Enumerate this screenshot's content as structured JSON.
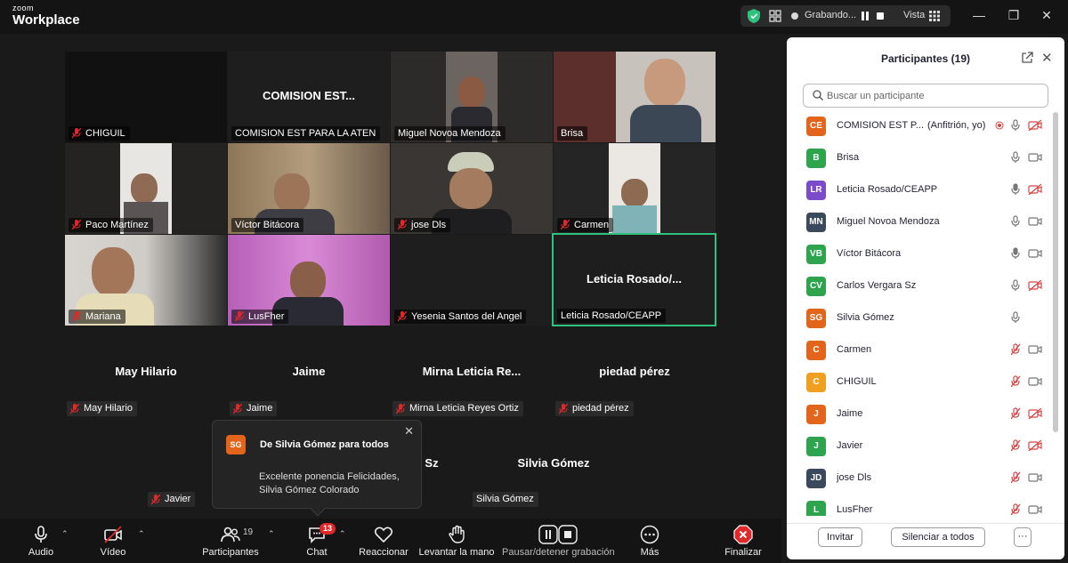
{
  "app": {
    "logo_small": "zoom",
    "logo_big": "Workplace"
  },
  "titlebar": {
    "recording_text": "Grabando...",
    "view_label": "Vista"
  },
  "tiles": [
    {
      "label": "CHIGUIL",
      "big_name": "",
      "color": "#111111"
    },
    {
      "label": "COMISION EST PARA LA ATEN",
      "big_name": "COMISION  EST...",
      "color": "#1e1e1e"
    },
    {
      "label": "Miguel Novoa Mendoza",
      "big_name": "",
      "color": "#3a3632"
    },
    {
      "label": "Brisa",
      "big_name": "",
      "color": "#5a3a38"
    },
    {
      "label": "Paco Martínez",
      "big_name": "",
      "color": "#2b2724"
    },
    {
      "label": "Víctor Bitácora",
      "big_name": "",
      "color": "#6e5a44"
    },
    {
      "label": "jose Dls",
      "big_name": "",
      "color": "#3d3935"
    },
    {
      "label": "Carmen",
      "big_name": "",
      "color": "#2a2a2a"
    },
    {
      "label": "Mariana",
      "big_name": "",
      "color": "#d3d0cc"
    },
    {
      "label": "LusFher",
      "big_name": "",
      "color": "#c46ec4"
    },
    {
      "label": "Yesenia Santos del Angel",
      "big_name": "",
      "color": "#1e1e1e"
    },
    {
      "label": "Leticia Rosado/CEAPP",
      "big_name": "Leticia  Rosado/...",
      "color": "#1e1e1e"
    }
  ],
  "floating": [
    {
      "name": "May Hilario",
      "label": "May Hilario"
    },
    {
      "name": "Jaime",
      "label": "Jaime"
    },
    {
      "name": "Mirna  Leticia  Re...",
      "label": "Mirna Leticia Reyes Ortiz"
    },
    {
      "name": "piedad pérez",
      "label": "piedad pérez"
    },
    {
      "name": "Sz",
      "label": "Javier"
    },
    {
      "name": "Silvia Gómez",
      "label": "Silvia Gómez"
    }
  ],
  "toast": {
    "avatar": "SG",
    "from": "De Silvia Gómez para todos",
    "message": "Excelente ponencia Felicidades, Silvia Gómez Colorado"
  },
  "toolbar": {
    "audio": "Audio",
    "video": "Vídeo",
    "participants": "Participantes",
    "participants_count": "19",
    "chat": "Chat",
    "chat_badge": "13",
    "react": "Reaccionar",
    "raise_hand": "Levantar la mano",
    "pause_rec": "Pausar/detener grabación",
    "more": "Más",
    "end": "Finalizar"
  },
  "panel": {
    "title": "Participantes (19)",
    "search_placeholder": "Buscar un participante",
    "invite": "Invitar",
    "mute_all": "Silenciar a todos",
    "more": "···",
    "participants": [
      {
        "initials": "CE",
        "name": "COMISION EST P...",
        "role": "(Anfitrión, yo)",
        "color": "#e2651b",
        "mic": "rec",
        "cam": "off"
      },
      {
        "initials": "B",
        "name": "Brisa",
        "role": "",
        "color": "#2ea44f",
        "mic": "on",
        "cam": "on"
      },
      {
        "initials": "LR",
        "name": "Leticia Rosado/CEAPP",
        "role": "",
        "color": "#7b4bc9",
        "mic": "on-active",
        "cam": "off"
      },
      {
        "initials": "MN",
        "name": "Miguel Novoa Mendoza",
        "role": "",
        "color": "#3a4a5c",
        "mic": "on",
        "cam": "on"
      },
      {
        "initials": "VB",
        "name": "Víctor Bitácora",
        "role": "",
        "color": "#2ea44f",
        "mic": "on-active",
        "cam": "on"
      },
      {
        "initials": "CV",
        "name": "Carlos Vergara Sz",
        "role": "",
        "color": "#2ea44f",
        "mic": "on",
        "cam": "off"
      },
      {
        "initials": "SG",
        "name": "Silvia Gómez",
        "role": "",
        "color": "#e2651b",
        "mic": "on",
        "cam": "none"
      },
      {
        "initials": "C",
        "name": "Carmen",
        "role": "",
        "color": "#e2651b",
        "mic": "muted",
        "cam": "on"
      },
      {
        "initials": "C",
        "name": "CHIGUIL",
        "role": "",
        "color": "#f0a020",
        "mic": "muted",
        "cam": "on"
      },
      {
        "initials": "J",
        "name": "Jaime",
        "role": "",
        "color": "#e2651b",
        "mic": "muted",
        "cam": "off"
      },
      {
        "initials": "J",
        "name": "Javier",
        "role": "",
        "color": "#2ea44f",
        "mic": "muted",
        "cam": "off"
      },
      {
        "initials": "JD",
        "name": "jose Dls",
        "role": "",
        "color": "#3a4a5c",
        "mic": "muted",
        "cam": "on"
      },
      {
        "initials": "L",
        "name": "LusFher",
        "role": "",
        "color": "#2ea44f",
        "mic": "muted",
        "cam": "on"
      }
    ]
  },
  "colors": {
    "accent_green": "#2ec27e",
    "end_red": "#e02828",
    "mic_off_red": "#e02828"
  }
}
